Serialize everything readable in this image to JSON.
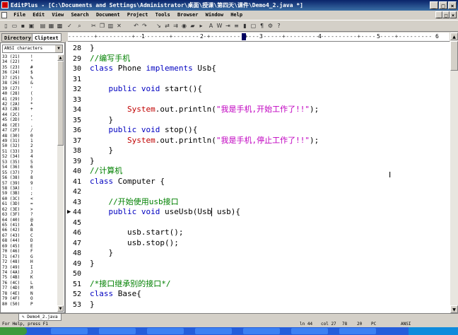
{
  "window": {
    "title": "EditPlus - [C:\\Documents and Settings\\Administrator\\桌面\\授课\\第四天\\课件\\Demo4_2.java *]",
    "buttons": [
      "_",
      "□",
      "×"
    ]
  },
  "menu": {
    "items": [
      "File",
      "Edit",
      "View",
      "Search",
      "Document",
      "Project",
      "Tools",
      "Browser",
      "Window",
      "Help"
    ],
    "mdi_controls": [
      "_",
      "□",
      "×"
    ]
  },
  "sidebar": {
    "tabs": [
      "Directory",
      "Cliptext"
    ],
    "active_tab": "Cliptext",
    "select_value": "ANSI characters",
    "cliptext": [
      {
        "code": "33 (21)",
        "char": "!"
      },
      {
        "code": "34 (22)",
        "char": "\""
      },
      {
        "code": "35 (23)",
        "char": "#"
      },
      {
        "code": "36 (24)",
        "char": "$"
      },
      {
        "code": "37 (25)",
        "char": "%"
      },
      {
        "code": "38 (26)",
        "char": "&"
      },
      {
        "code": "39 (27)",
        "char": "'"
      },
      {
        "code": "40 (28)",
        "char": "("
      },
      {
        "code": "41 (29)",
        "char": ")"
      },
      {
        "code": "42 (2A)",
        "char": "*"
      },
      {
        "code": "43 (2B)",
        "char": "+"
      },
      {
        "code": "44 (2C)",
        "char": ","
      },
      {
        "code": "45 (2D)",
        "char": "-"
      },
      {
        "code": "46 (2E)",
        "char": "."
      },
      {
        "code": "47 (2F)",
        "char": "/"
      },
      {
        "code": "48 (30)",
        "char": "0"
      },
      {
        "code": "49 (31)",
        "char": "1"
      },
      {
        "code": "50 (32)",
        "char": "2"
      },
      {
        "code": "51 (33)",
        "char": "3"
      },
      {
        "code": "52 (34)",
        "char": "4"
      },
      {
        "code": "53 (35)",
        "char": "5"
      },
      {
        "code": "54 (36)",
        "char": "6"
      },
      {
        "code": "55 (37)",
        "char": "7"
      },
      {
        "code": "56 (38)",
        "char": "8"
      },
      {
        "code": "57 (39)",
        "char": "9"
      },
      {
        "code": "58 (3A)",
        "char": ":"
      },
      {
        "code": "59 (3B)",
        "char": ";"
      },
      {
        "code": "60 (3C)",
        "char": "<"
      },
      {
        "code": "61 (3D)",
        "char": "="
      },
      {
        "code": "62 (3E)",
        "char": ">"
      },
      {
        "code": "63 (3F)",
        "char": "?"
      },
      {
        "code": "64 (40)",
        "char": "@"
      },
      {
        "code": "65 (41)",
        "char": "A"
      },
      {
        "code": "66 (42)",
        "char": "B"
      },
      {
        "code": "67 (43)",
        "char": "C"
      },
      {
        "code": "68 (44)",
        "char": "D"
      },
      {
        "code": "69 (45)",
        "char": "E"
      },
      {
        "code": "70 (46)",
        "char": "F"
      },
      {
        "code": "71 (47)",
        "char": "G"
      },
      {
        "code": "72 (48)",
        "char": "H"
      },
      {
        "code": "73 (49)",
        "char": "I"
      },
      {
        "code": "74 (4A)",
        "char": "J"
      },
      {
        "code": "75 (4B)",
        "char": "K"
      },
      {
        "code": "76 (4C)",
        "char": "L"
      },
      {
        "code": "77 (4D)",
        "char": "M"
      },
      {
        "code": "78 (4E)",
        "char": "N"
      },
      {
        "code": "79 (4F)",
        "char": "O"
      },
      {
        "code": "80 (50)",
        "char": "P"
      }
    ]
  },
  "ruler": {
    "numbers": [
      "1",
      "2",
      "3",
      "4",
      "5",
      "6"
    ]
  },
  "editor": {
    "lines": [
      {
        "n": "28",
        "tokens": [
          {
            "t": "}",
            "c": ""
          }
        ]
      },
      {
        "n": "29",
        "tokens": [
          {
            "t": "//编写手机",
            "c": "cm"
          }
        ]
      },
      {
        "n": "30",
        "tokens": [
          {
            "t": "class",
            "c": "kw"
          },
          {
            "t": " Phone ",
            "c": ""
          },
          {
            "t": "implements",
            "c": "kw"
          },
          {
            "t": " Usb{",
            "c": ""
          }
        ]
      },
      {
        "n": "31",
        "tokens": []
      },
      {
        "n": "32",
        "tokens": [
          {
            "t": "    ",
            "c": ""
          },
          {
            "t": "public",
            "c": "kw"
          },
          {
            "t": " ",
            "c": ""
          },
          {
            "t": "void",
            "c": "kw"
          },
          {
            "t": " start(){",
            "c": ""
          }
        ]
      },
      {
        "n": "33",
        "tokens": []
      },
      {
        "n": "34",
        "tokens": [
          {
            "t": "        ",
            "c": ""
          },
          {
            "t": "System",
            "c": "sys"
          },
          {
            "t": ".out.println(",
            "c": ""
          },
          {
            "t": "\"我是手机,开始工作了!!\"",
            "c": "str"
          },
          {
            "t": ");",
            "c": ""
          }
        ]
      },
      {
        "n": "35",
        "tokens": [
          {
            "t": "    }",
            "c": ""
          }
        ]
      },
      {
        "n": "36",
        "tokens": [
          {
            "t": "    ",
            "c": ""
          },
          {
            "t": "public",
            "c": "kw"
          },
          {
            "t": " ",
            "c": ""
          },
          {
            "t": "void",
            "c": "kw"
          },
          {
            "t": " stop(){",
            "c": ""
          }
        ]
      },
      {
        "n": "37",
        "tokens": [
          {
            "t": "        ",
            "c": ""
          },
          {
            "t": "System",
            "c": "sys"
          },
          {
            "t": ".out.println(",
            "c": ""
          },
          {
            "t": "\"我是手机,停止工作了!!\"",
            "c": "str"
          },
          {
            "t": ");",
            "c": ""
          }
        ]
      },
      {
        "n": "38",
        "tokens": [
          {
            "t": "    }",
            "c": ""
          }
        ]
      },
      {
        "n": "39",
        "tokens": [
          {
            "t": "}",
            "c": ""
          }
        ]
      },
      {
        "n": "40",
        "tokens": [
          {
            "t": "//计算机",
            "c": "cm"
          }
        ]
      },
      {
        "n": "41",
        "tokens": [
          {
            "t": "class",
            "c": "kw"
          },
          {
            "t": " Computer {",
            "c": ""
          }
        ]
      },
      {
        "n": "42",
        "tokens": []
      },
      {
        "n": "43",
        "tokens": [
          {
            "t": "    ",
            "c": ""
          },
          {
            "t": "//开始使用usb接口",
            "c": "cm"
          }
        ]
      },
      {
        "n": "44",
        "tokens": [
          {
            "t": "    ",
            "c": ""
          },
          {
            "t": "public",
            "c": "kw"
          },
          {
            "t": " ",
            "c": ""
          },
          {
            "t": "void",
            "c": "kw"
          },
          {
            "t": " useUsb(Usb",
            "c": ""
          },
          {
            "t": "|",
            "c": "cursor"
          },
          {
            "t": " usb){",
            "c": ""
          }
        ],
        "marker": "▶"
      },
      {
        "n": "45",
        "tokens": []
      },
      {
        "n": "46",
        "tokens": [
          {
            "t": "        usb.start();",
            "c": ""
          }
        ]
      },
      {
        "n": "47",
        "tokens": [
          {
            "t": "        usb.stop();",
            "c": ""
          }
        ]
      },
      {
        "n": "48",
        "tokens": [
          {
            "t": "    }",
            "c": ""
          }
        ]
      },
      {
        "n": "49",
        "tokens": [
          {
            "t": "}",
            "c": ""
          }
        ]
      },
      {
        "n": "50",
        "tokens": []
      },
      {
        "n": "51",
        "tokens": [
          {
            "t": "/*接口继承别的接口*/",
            "c": "cm"
          }
        ]
      },
      {
        "n": "52",
        "tokens": [
          {
            "t": "class",
            "c": "kw"
          },
          {
            "t": " Base{",
            "c": ""
          }
        ]
      },
      {
        "n": "53",
        "tokens": [
          {
            "t": "}",
            "c": ""
          }
        ]
      }
    ]
  },
  "doc_tab": "Demo4_2.java",
  "status": {
    "help": "For Help, press F1",
    "line": "ln 44",
    "col": "col 27",
    "num1": "78",
    "num2": "20",
    "mode": "PC",
    "encoding": "ANSI"
  }
}
